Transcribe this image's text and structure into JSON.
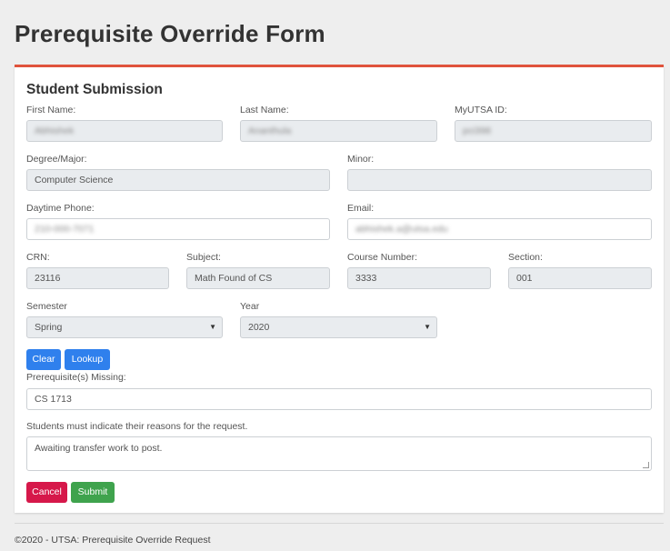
{
  "page": {
    "title": "Prerequisite Override Form"
  },
  "form": {
    "section_title": "Student Submission",
    "first_name": {
      "label": "First Name:",
      "value": "Abhishek"
    },
    "last_name": {
      "label": "Last Name:",
      "value": "Ananthula"
    },
    "myutsa_id": {
      "label": "MyUTSA ID:",
      "value": "pci398"
    },
    "degree_major": {
      "label": "Degree/Major:",
      "value": "Computer Science"
    },
    "minor": {
      "label": "Minor:",
      "value": ""
    },
    "daytime_phone": {
      "label": "Daytime Phone:",
      "value": "210-000-7071"
    },
    "email": {
      "label": "Email:",
      "value": "abhishek.a@utsa.edu"
    },
    "crn": {
      "label": "CRN:",
      "value": "23116"
    },
    "subject": {
      "label": "Subject:",
      "value": "Math Found of CS"
    },
    "course_number": {
      "label": "Course Number:",
      "value": "3333"
    },
    "section": {
      "label": "Section:",
      "value": "001"
    },
    "semester": {
      "label": "Semester",
      "value": "Spring"
    },
    "year": {
      "label": "Year",
      "value": "2020"
    },
    "buttons": {
      "clear": "Clear",
      "lookup": "Lookup",
      "cancel": "Cancel",
      "submit": "Submit"
    },
    "prereq_missing": {
      "label": "Prerequisite(s) Missing:",
      "value": "CS 1713"
    },
    "reasons": {
      "label": "Students must indicate their reasons for the request.",
      "value": "Awaiting transfer work to post."
    }
  },
  "footer": {
    "text": "©2020 - UTSA: Prerequisite Override Request"
  },
  "colors": {
    "accent": "#e0533c",
    "primary": "#2f80ed",
    "danger": "#d6184a",
    "success": "#3fa34d"
  }
}
